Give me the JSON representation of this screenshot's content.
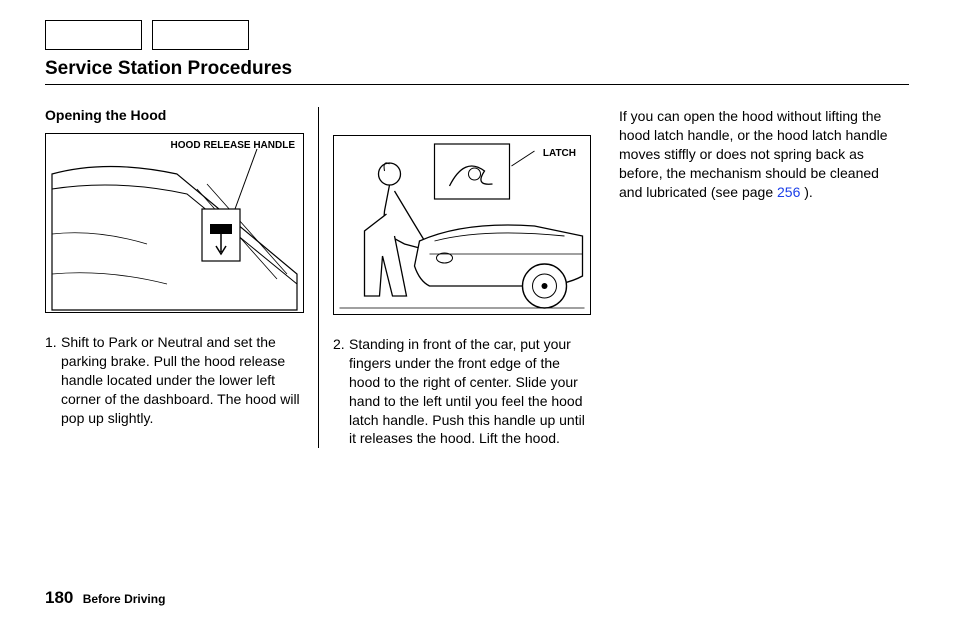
{
  "pageTitle": "Service Station Procedures",
  "sectionHeading": "Opening the Hood",
  "figure1Label": "HOOD RELEASE HANDLE",
  "figure2Label": "LATCH",
  "step1Number": "1.",
  "step1Text": "Shift to Park or Neutral and set the parking brake. Pull the hood release handle located under the lower left corner of the dashboard. The hood will pop up slightly.",
  "step2Number": "2.",
  "step2Text": "Standing in front of the car, put your fingers under the front edge of the hood to the right of center. Slide your hand to the left until you feel the hood latch handle. Push this handle up until it releases the hood. Lift the hood.",
  "rightParagraphPrefix": "If you can open the hood without lifting the hood latch handle, or the hood latch handle moves stiffly or does not spring back as before, the mechanism should be cleaned and lubricated (see page ",
  "crossRefPage": "256",
  "rightParagraphSuffix": " ).",
  "pageNumber": "180",
  "footerSection": "Before Driving"
}
